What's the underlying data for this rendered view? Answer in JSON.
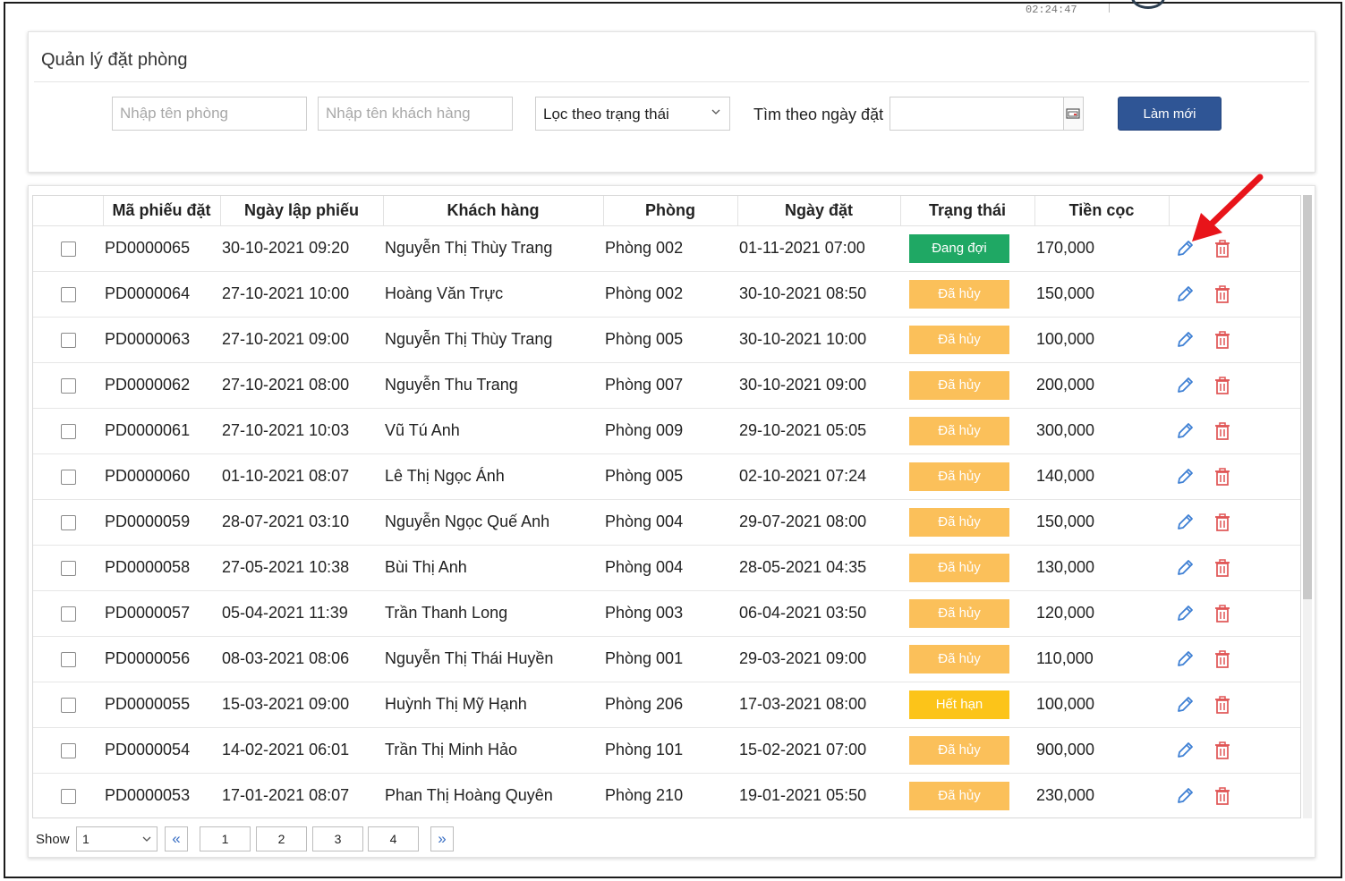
{
  "top_clip": {
    "text": "02:24:47"
  },
  "filter": {
    "title": "Quản lý đặt phòng",
    "room_placeholder": "Nhập tên phòng",
    "customer_placeholder": "Nhập tên khách hàng",
    "status_select": "Lọc theo trạng thái",
    "date_label": "Tìm theo ngày đặt",
    "refresh_label": "Làm mới"
  },
  "table": {
    "headers": [
      "",
      "Mã phiếu đặt",
      "Ngày lập phiếu",
      "Khách hàng",
      "Phòng",
      "Ngày đặt",
      "Trạng thái",
      "Tiền cọc",
      ""
    ],
    "rows": [
      {
        "code": "PD0000065",
        "created": "30-10-2021 09:20",
        "customer": "Nguyễn Thị Thùy Trang",
        "room": "Phòng 002",
        "booked": "01-11-2021 07:00",
        "status": "Đang đợi",
        "deposit": "170,000"
      },
      {
        "code": "PD0000064",
        "created": "27-10-2021 10:00",
        "customer": "Hoàng Văn Trực",
        "room": "Phòng 002",
        "booked": "30-10-2021 08:50",
        "status": "Đã hủy",
        "deposit": "150,000"
      },
      {
        "code": "PD0000063",
        "created": "27-10-2021 09:00",
        "customer": "Nguyễn Thị Thùy Trang",
        "room": "Phòng 005",
        "booked": "30-10-2021 10:00",
        "status": "Đã hủy",
        "deposit": "100,000"
      },
      {
        "code": "PD0000062",
        "created": "27-10-2021 08:00",
        "customer": "Nguyễn Thu Trang",
        "room": "Phòng 007",
        "booked": "30-10-2021 09:00",
        "status": "Đã hủy",
        "deposit": "200,000"
      },
      {
        "code": "PD0000061",
        "created": "27-10-2021 10:03",
        "customer": "Vũ Tú Anh",
        "room": "Phòng 009",
        "booked": "29-10-2021 05:05",
        "status": "Đã hủy",
        "deposit": "300,000"
      },
      {
        "code": "PD0000060",
        "created": "01-10-2021 08:07",
        "customer": "Lê Thị Ngọc Ánh",
        "room": "Phòng 005",
        "booked": "02-10-2021 07:24",
        "status": "Đã hủy",
        "deposit": "140,000"
      },
      {
        "code": "PD0000059",
        "created": "28-07-2021 03:10",
        "customer": "Nguyễn Ngọc Quế Anh",
        "room": "Phòng 004",
        "booked": "29-07-2021 08:00",
        "status": "Đã hủy",
        "deposit": "150,000"
      },
      {
        "code": "PD0000058",
        "created": "27-05-2021 10:38",
        "customer": "Bùi Thị Anh",
        "room": "Phòng 004",
        "booked": "28-05-2021 04:35",
        "status": "Đã hủy",
        "deposit": "130,000"
      },
      {
        "code": "PD0000057",
        "created": "05-04-2021 11:39",
        "customer": "Trần Thanh Long",
        "room": "Phòng 003",
        "booked": "06-04-2021 03:50",
        "status": "Đã hủy",
        "deposit": "120,000"
      },
      {
        "code": "PD0000056",
        "created": "08-03-2021 08:06",
        "customer": "Nguyễn Thị Thái Huyền",
        "room": "Phòng 001",
        "booked": "29-03-2021 09:00",
        "status": "Đã hủy",
        "deposit": "110,000"
      },
      {
        "code": "PD0000055",
        "created": "15-03-2021 09:00",
        "customer": "Huỳnh Thị Mỹ Hạnh",
        "room": "Phòng 206",
        "booked": "17-03-2021 08:00",
        "status": "Hết hạn",
        "deposit": "100,000"
      },
      {
        "code": "PD0000054",
        "created": "14-02-2021 06:01",
        "customer": "Trần Thị Minh Hảo",
        "room": "Phòng 101",
        "booked": "15-02-2021 07:00",
        "status": "Đã hủy",
        "deposit": "900,000"
      },
      {
        "code": "PD0000053",
        "created": "17-01-2021 08:07",
        "customer": "Phan Thị Hoàng Quyên",
        "room": "Phòng 210",
        "booked": "19-01-2021 05:50",
        "status": "Đã hủy",
        "deposit": "230,000"
      }
    ]
  },
  "status_colors": {
    "Đang đợi": "#1fa864",
    "Đã hủy": "#fbc05a",
    "Hết hạn": "#fcc419"
  },
  "icons": {
    "edit": "pencil-icon",
    "delete": "trash-icon"
  },
  "pagination": {
    "show_label": "Show",
    "page_size": "1",
    "pages": [
      "1",
      "2",
      "3",
      "4"
    ],
    "prev_icon": "«",
    "next_icon": "»"
  }
}
